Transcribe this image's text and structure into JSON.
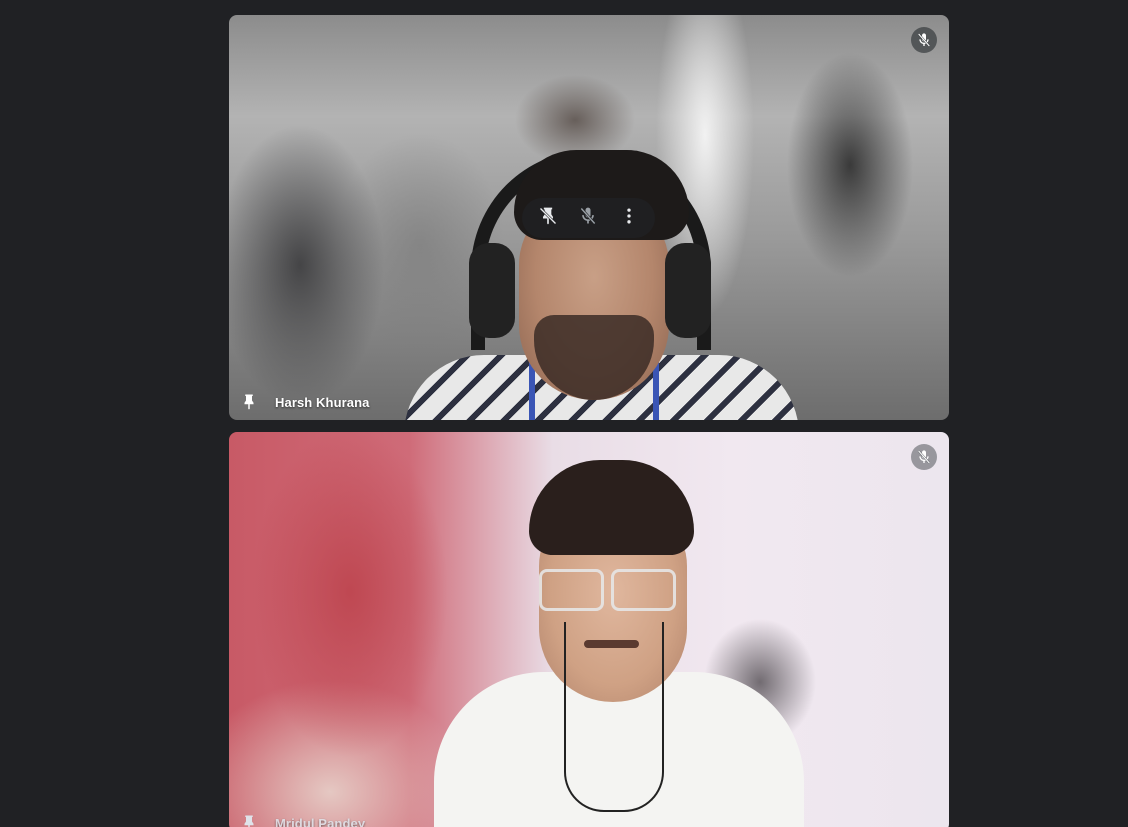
{
  "participants": [
    {
      "name": "Harsh Khurana",
      "muted": true,
      "pin_icon": "pin-icon",
      "mute_icon": "mic-off-icon",
      "hover_controls": [
        "pin-off-icon",
        "mic-off-icon",
        "more-vert-icon"
      ]
    },
    {
      "name": "Mridul Pandey",
      "muted": true,
      "pin_icon": "pin-icon",
      "mute_icon": "mic-off-icon"
    }
  ],
  "colors": {
    "background": "#202124",
    "name_text": "#ffffff",
    "overlay": "#3c4043"
  }
}
